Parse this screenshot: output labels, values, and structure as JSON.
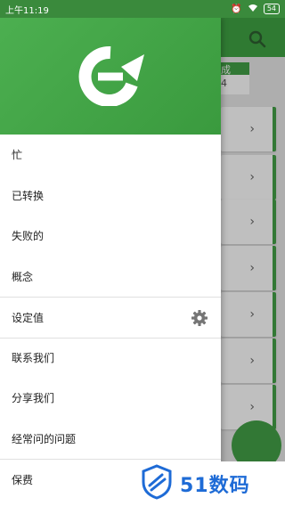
{
  "status": {
    "time": "上午11:19",
    "battery": "54"
  },
  "background": {
    "tab_label_top": "成",
    "tab_label_bottom": "4"
  },
  "drawer": {
    "items": [
      {
        "label": "忙"
      },
      {
        "label": "已转换"
      },
      {
        "label": "失败的"
      },
      {
        "label": "概念"
      },
      {
        "label": "设定值"
      },
      {
        "label": "联系我们"
      },
      {
        "label": "分享我们"
      },
      {
        "label": "经常问的问题"
      },
      {
        "label": "保费"
      }
    ]
  },
  "watermark": {
    "text": "51数码"
  },
  "colors": {
    "primary": "#43a047",
    "status_bar": "#3a8a3c",
    "watermark": "#1e6bd6"
  }
}
